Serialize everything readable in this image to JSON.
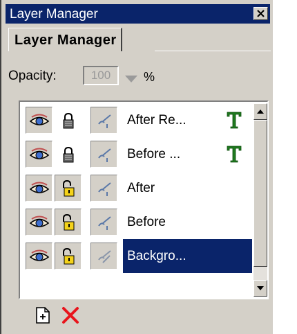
{
  "window": {
    "title": "Layer Manager"
  },
  "tab": {
    "label": "Layer Manager"
  },
  "opacity": {
    "label": "Opacity:",
    "value": "100",
    "unit": "%"
  },
  "layers": [
    {
      "name": "After Re...",
      "locked": true,
      "text_layer": true,
      "selected": false
    },
    {
      "name": "Before ...",
      "locked": true,
      "text_layer": true,
      "selected": false
    },
    {
      "name": "After",
      "locked": false,
      "text_layer": false,
      "selected": false
    },
    {
      "name": "Before",
      "locked": false,
      "text_layer": false,
      "selected": false
    },
    {
      "name": "Backgro...",
      "locked": false,
      "text_layer": false,
      "selected": true
    }
  ],
  "colors": {
    "titlebar": "#0a246a",
    "selection": "#0a246a",
    "text_icon": "#1f7a1f",
    "delete_icon": "#e8141c",
    "face": "#d4d0c8"
  },
  "icons": {
    "visibility": "eye-icon",
    "lock": "padlock-icon",
    "link": "link-brush-icon",
    "text": "text-layer-icon",
    "new": "new-layer-icon",
    "delete": "delete-layer-icon"
  }
}
